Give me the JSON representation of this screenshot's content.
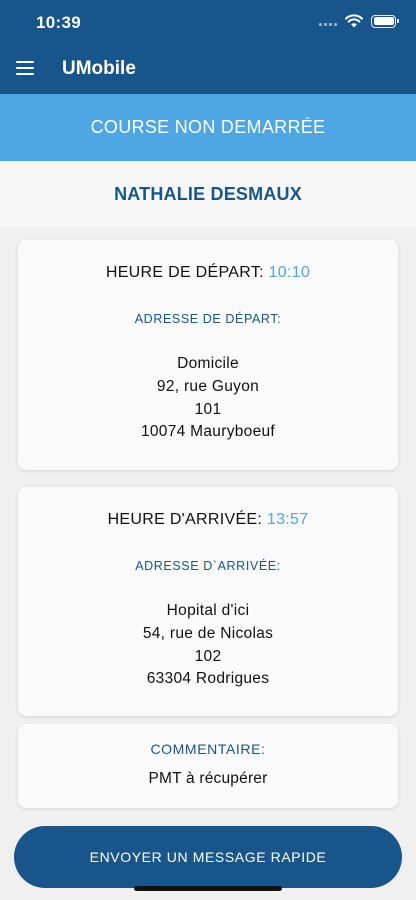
{
  "status_bar": {
    "time": "10:39"
  },
  "app_bar": {
    "title": "UMobile"
  },
  "course_status": "COURSE NON DEMARRÉE",
  "patient_name": "NATHALIE DESMAUX",
  "departure": {
    "time_label": "HEURE DE DÉPART: ",
    "time": "10:10",
    "address_label": "ADRESSE DE DÉPART:",
    "address_lines": [
      "Domicile",
      "92, rue Guyon",
      "101",
      "10074 Mauryboeuf"
    ]
  },
  "arrival": {
    "time_label": "HEURE D'ARRIVÉE: ",
    "time": "13:57",
    "address_label": "ADRESSE D`ARRIVÉE:",
    "address_lines": [
      "Hopital d'ici",
      "54, rue de Nicolas",
      "102",
      "63304 Rodrigues"
    ]
  },
  "comment": {
    "label": "COMMENTAIRE:",
    "text": "PMT à récupérer"
  },
  "send_button_label": "ENVOYER UN MESSAGE RAPIDE",
  "colors": {
    "primary": "#17558a",
    "accent": "#4ea6e2",
    "background": "#f0f0f0",
    "card": "#fafafa"
  },
  "icons": {
    "menu": "hamburger-menu-icon",
    "signal": "cellular-signal-icon",
    "wifi": "wifi-icon",
    "battery": "battery-icon"
  }
}
